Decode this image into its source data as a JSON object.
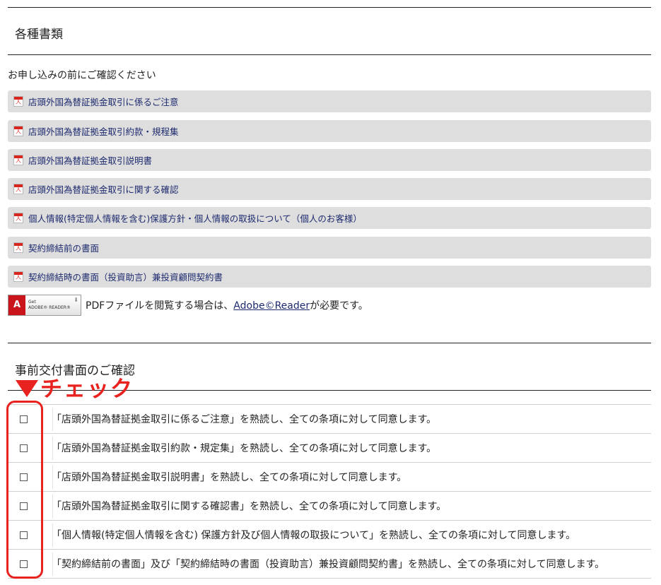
{
  "documents_section": {
    "title": "各種書類",
    "intro": "お申し込みの前にご確認ください",
    "items": [
      {
        "label": "店頭外国為替証拠金取引に係るご注意"
      },
      {
        "label": "店頭外国為替証拠金取引約款・規程集"
      },
      {
        "label": "店頭外国為替証拠金取引説明書"
      },
      {
        "label": "店頭外国為替証拠金取引に関する確認"
      },
      {
        "label": "個人情報(特定個人情報を含む)保護方針・個人情報の取扱について（個人のお客様）"
      },
      {
        "label": "契約締結前の書面"
      },
      {
        "label": "契約締結時の書面（投資助言）兼投資顧問契約書"
      }
    ],
    "adobe": {
      "badge_line1": "Get",
      "badge_line2": "ADOBE® READER®",
      "note_before": "PDFファイルを閲覧する場合は、",
      "note_link": "Adobe©Reader",
      "note_after": "が必要です。"
    }
  },
  "agreement_section": {
    "title": "事前交付書面のご確認",
    "check_label": "チェック",
    "items": [
      {
        "text": "「店頭外国為替証拠金取引に係るご注意」を熟読し、全ての条項に対して同意します。",
        "checked": false
      },
      {
        "text": "「店頭外国為替証拠金取引約款・規定集」を熟読し、全ての条項に対して同意します。",
        "checked": false
      },
      {
        "text": "「店頭外国為替証拠金取引説明書」を熟読し、全ての条項に対して同意します。",
        "checked": false
      },
      {
        "text": "「店頭外国為替証拠金取引に関する確認書」を熟読し、全ての条項に対して同意します。",
        "checked": false
      },
      {
        "text": "「個人情報(特定個人情報を含む) 保護方針及び個人情報の取扱について」を熟読し、全ての条項に対して同意します。",
        "checked": false
      },
      {
        "text": "「契約締結前の書面」及び「契約締結時の書面（投資助言）兼投資顧問契約書」を熟読し、全ての条項に対して同意します。",
        "checked": false
      }
    ]
  },
  "colors": {
    "accent_red": "#e8231f",
    "link_navy": "#1d2a6e",
    "item_bg": "#dedede"
  }
}
